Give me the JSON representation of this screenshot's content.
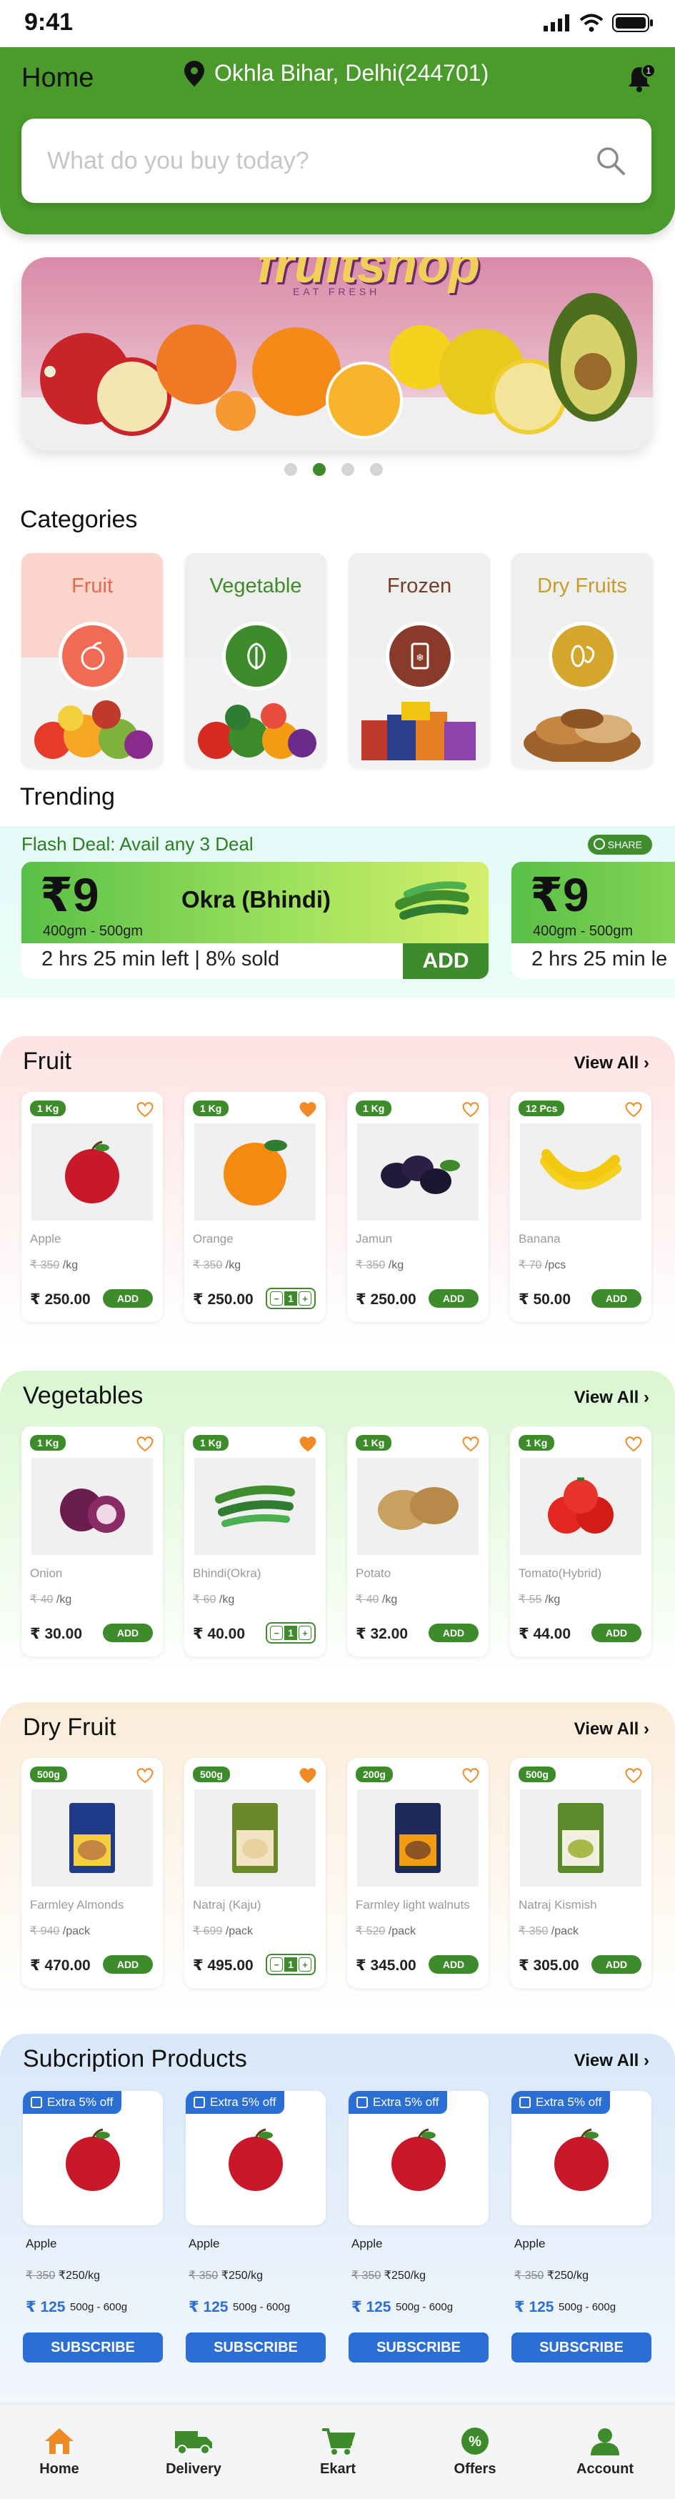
{
  "status": {
    "time": "9:41"
  },
  "header": {
    "title": "Home",
    "location": "Okhla Bihar, Delhi(244701)",
    "notif_count": "1"
  },
  "search": {
    "placeholder": "What do you buy today?"
  },
  "banner": {
    "brand": "fruitshop",
    "tagline": "EAT FRESH",
    "active_dot": 1,
    "dots": 4
  },
  "categories": {
    "title": "Categories",
    "items": [
      {
        "label": "Fruit",
        "color": "#e66a4f"
      },
      {
        "label": "Vegetable",
        "color": "#3e8b2c"
      },
      {
        "label": "Frozen",
        "color": "#7b3b2a"
      },
      {
        "label": "Dry Fruits",
        "color": "#c99b2b"
      }
    ]
  },
  "trending": {
    "title": "Trending",
    "flash_label": "Flash Deal: Avail any 3 Deal",
    "share": "SHARE",
    "cards": [
      {
        "price": "₹9",
        "name": "Okra (Bhindi)",
        "weight": "400gm - 500gm",
        "left": "2 hrs 25 min left | 8% sold",
        "add": "ADD"
      },
      {
        "price": "₹9",
        "weight": "400gm - 500gm",
        "left": "2 hrs 25 min le"
      }
    ]
  },
  "fruit": {
    "title": "Fruit",
    "view_all": "View All",
    "items": [
      {
        "badge": "1 Kg",
        "name": "Apple",
        "old": "₹ 350",
        "unit": "/kg",
        "price": "₹ 250.00",
        "action": "ADD",
        "fav": false
      },
      {
        "badge": "1 Kg",
        "name": "Orange",
        "old": "₹ 350",
        "unit": "/kg",
        "price": "₹ 250.00",
        "action": "stepper",
        "qty": "1",
        "fav": true
      },
      {
        "badge": "1 Kg",
        "name": "Jamun",
        "old": "₹ 350",
        "unit": "/kg",
        "price": "₹ 250.00",
        "action": "ADD",
        "fav": false
      },
      {
        "badge": "12 Pcs",
        "name": "Banana",
        "old": "₹ 70",
        "unit": "/pcs",
        "price": "₹ 50.00",
        "action": "ADD",
        "fav": false
      }
    ]
  },
  "vegetables": {
    "title": "Vegetables",
    "view_all": "View All",
    "items": [
      {
        "badge": "1 Kg",
        "name": "Onion",
        "old": "₹ 40",
        "unit": "/kg",
        "price": "₹ 30.00",
        "action": "ADD",
        "fav": false
      },
      {
        "badge": "1 Kg",
        "name": "Bhindi(Okra)",
        "old": "₹ 60",
        "unit": "/kg",
        "price": "₹ 40.00",
        "action": "stepper",
        "qty": "1",
        "fav": true
      },
      {
        "badge": "1 Kg",
        "name": "Potato",
        "old": "₹ 40",
        "unit": "/kg",
        "price": "₹ 32.00",
        "action": "ADD",
        "fav": false
      },
      {
        "badge": "1 Kg",
        "name": "Tomato(Hybrid)",
        "old": "₹ 55",
        "unit": "/kg",
        "price": "₹ 44.00",
        "action": "ADD",
        "fav": false
      }
    ]
  },
  "dryfruit": {
    "title": "Dry Fruit",
    "view_all": "View All",
    "items": [
      {
        "badge": "500g",
        "name": "Farmley Almonds",
        "old": "₹ 940",
        "unit": "/pack",
        "price": "₹ 470.00",
        "action": "ADD",
        "fav": false
      },
      {
        "badge": "500g",
        "name": "Natraj (Kaju)",
        "old": "₹ 699",
        "unit": "/pack",
        "price": "₹ 495.00",
        "action": "stepper",
        "qty": "1",
        "fav": true
      },
      {
        "badge": "200g",
        "name": "Farmley light walnuts",
        "old": "₹ 520",
        "unit": "/pack",
        "price": "₹ 345.00",
        "action": "ADD",
        "fav": false
      },
      {
        "badge": "500g",
        "name": "Natraj Kismish",
        "old": "₹ 350",
        "unit": "/pack",
        "price": "₹ 305.00",
        "action": "ADD",
        "fav": false
      }
    ]
  },
  "subscription": {
    "title": "Subcription Products",
    "view_all": "View All",
    "items": [
      {
        "tag": "Extra 5% off",
        "name": "Apple",
        "old": "₹ 350",
        "now": "₹250/kg",
        "price": "₹ 125",
        "range": "500g - 600g",
        "button": "SUBSCRIBE"
      },
      {
        "tag": "Extra 5% off",
        "name": "Apple",
        "old": "₹ 350",
        "now": "₹250/kg",
        "price": "₹ 125",
        "range": "500g - 600g",
        "button": "SUBSCRIBE"
      },
      {
        "tag": "Extra 5% off",
        "name": "Apple",
        "old": "₹ 350",
        "now": "₹250/kg",
        "price": "₹ 125",
        "range": "500g - 600g",
        "button": "SUBSCRIBE"
      },
      {
        "tag": "Extra 5% off",
        "name": "Apple",
        "old": "₹ 350",
        "now": "₹250/kg",
        "price": "₹ 125",
        "range": "500g - 600g",
        "button": "SUBSCRIBE"
      }
    ]
  },
  "nav": {
    "items": [
      {
        "label": "Home",
        "icon": "home-icon",
        "active": true
      },
      {
        "label": "Delivery",
        "icon": "truck-icon"
      },
      {
        "label": "Ekart",
        "icon": "cart-icon"
      },
      {
        "label": "Offers",
        "icon": "offers-icon"
      },
      {
        "label": "Account",
        "icon": "account-icon"
      }
    ]
  },
  "colors": {
    "brand": "#4a9a2c",
    "accent": "#3e8b2c",
    "blue": "#2b6fd4",
    "heart": "#f08a24"
  }
}
